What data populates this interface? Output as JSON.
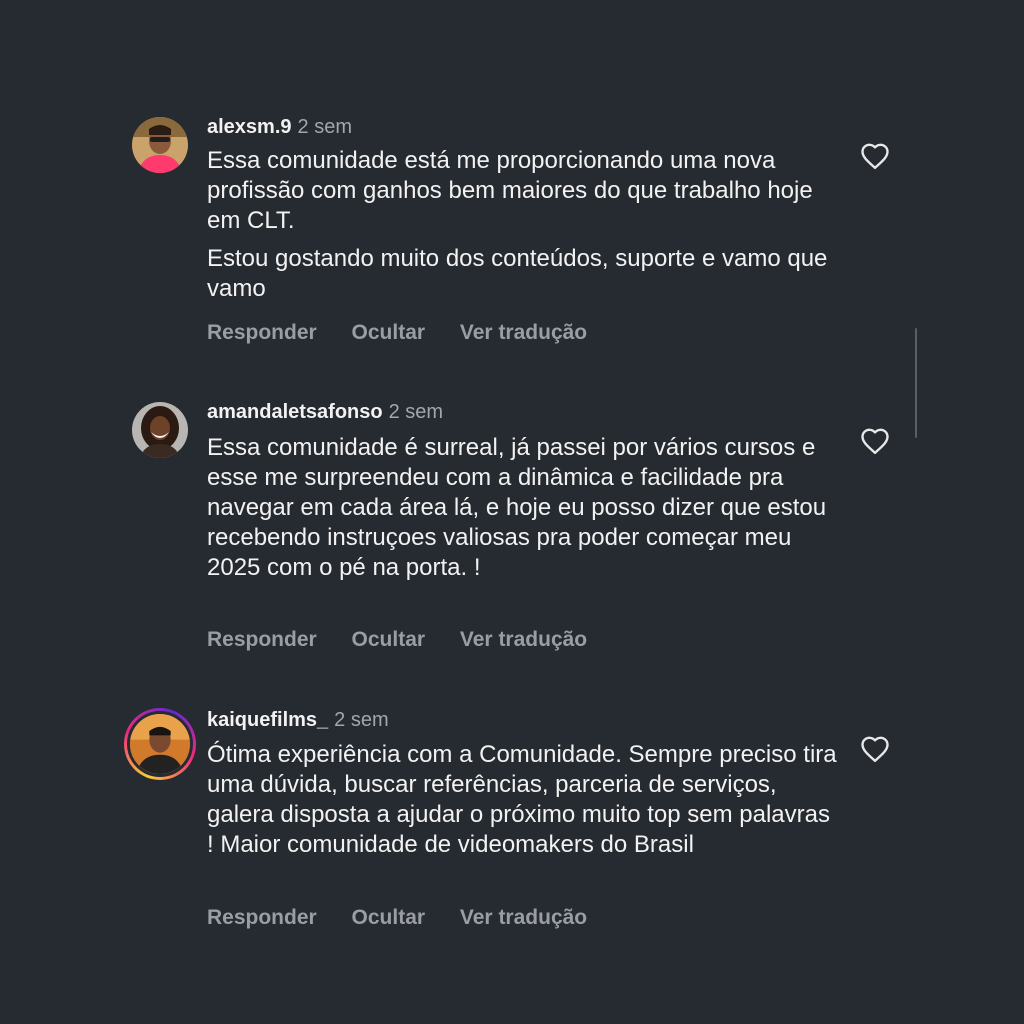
{
  "comments": [
    {
      "username": "alexsm.9",
      "time": "2 sem",
      "paragraphs": [
        "Essa comunidade está me proporcionando uma nova profissão com ganhos bem maiores do que trabalho hoje em CLT.",
        "Estou gostando muito dos conteúdos, suporte e vamo que vamo"
      ],
      "actions": {
        "reply": "Responder",
        "hide": "Ocultar",
        "translate": "Ver tradução"
      }
    },
    {
      "username": "amandaletsafonso",
      "time": "2 sem",
      "paragraphs": [
        "Essa comunidade é surreal, já passei por vários cursos e esse me surpreendeu com a dinâmica e facilidade pra navegar em cada área lá, e hoje eu posso dizer que estou recebendo instruçoes valiosas pra poder começar meu 2025 com o pé na porta. !"
      ],
      "actions": {
        "reply": "Responder",
        "hide": "Ocultar",
        "translate": "Ver tradução"
      }
    },
    {
      "username": "kaiquefilms_",
      "time": "2 sem",
      "paragraphs": [
        "Ótima experiência com a Comunidade. Sempre preciso tira uma dúvida, buscar referências, parceria de serviços, galera disposta a ajudar o próximo muito top sem palavras ! Maior comunidade de videomakers do  Brasil"
      ],
      "actions": {
        "reply": "Responder",
        "hide": "Ocultar",
        "translate": "Ver tradução"
      }
    }
  ],
  "icons": {
    "like": "heart-outline-icon"
  },
  "colors": {
    "background": "#262a31",
    "text": "#f2f2f2",
    "secondary_text": "#a3a6ab",
    "action_text": "#9a9da3"
  }
}
